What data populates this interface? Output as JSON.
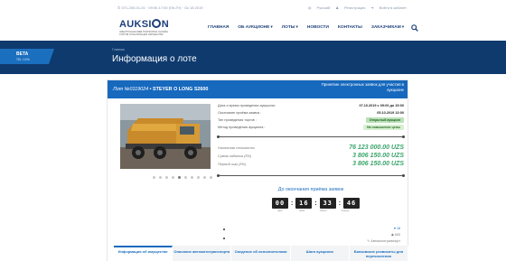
{
  "topbar": {
    "contacts": "✆ 371-200-01-01  ·  09:00-17:00 (Пн-Пт)  ·  Ок 18 2019",
    "language": "Русский",
    "register": "Регистрация",
    "login": "Войти в кабинет"
  },
  "logo": {
    "name_left": "AUKSI",
    "name_right": "N",
    "subtitle": "ЭЛЕКТРОННАЯ ВЕБ-ПЛАТФОРМА ОНЛАЙН ТОРГОВ И РЕАЛИЗАЦИИ ИМУЩЕСТВА"
  },
  "nav": {
    "items": [
      "ГЛАВНАЯ",
      "ОБ АУКЦИОНЕ",
      "ЛОТЫ",
      "НОВОСТИ",
      "КОНТАКТЫ",
      "ЗАКАЗЧИКАМ"
    ]
  },
  "hero": {
    "breadcrumb": "Главная",
    "title": "Информация о лоте"
  },
  "beta": {
    "label": "BETA",
    "sublabel": "TEL: 0.0%"
  },
  "lot": {
    "prefix": "Лот №",
    "number": "0119024",
    "name": "• STEYER O LONG S2600",
    "status": "Принятие электронных заявок для участия в аукционе"
  },
  "details": {
    "rows": [
      {
        "label": "Дата и время проведения аукциона:",
        "value": "07.10.2019 с 09:00 до 15:00"
      },
      {
        "label": "Окончание приёма заявок :",
        "value": "05.10.2019 13:00"
      },
      {
        "label": "Тип проведения торгов :",
        "value": "Открытый аукцион"
      },
      {
        "label": "Метод проведения аукциона :",
        "value": "На повышение цены"
      }
    ],
    "prices": [
      {
        "label": "Начальная стоимость",
        "value": "76 123 000.00 UZS"
      },
      {
        "label": "Сумма задатка (5%)",
        "value": "3 806 150.00 UZS"
      },
      {
        "label": "Первый шаг (5%)",
        "value": "3 806 150.00 UZS"
      }
    ]
  },
  "countdown": {
    "title": "До окончания приёма заявок",
    "days": "00",
    "hours": "16",
    "minutes": "33",
    "seconds": "46",
    "labels": [
      "Дни",
      "Часы",
      "Минут",
      "Секунд"
    ]
  },
  "meta": {
    "likes": "♥ 18",
    "views": "◉ 600",
    "category": "✎ Автомототранспорт"
  },
  "tabs": [
    "Информация об имуществе",
    "Описание автомототранспорта",
    "Сведение об исполнителями",
    "Шаги аукциона",
    "Банковские реквизиты для перечисления"
  ],
  "colors": {
    "hero": "#0e3a6e",
    "card_header": "#1769be",
    "price": "#3aa56a",
    "beta": "#1b6fbf"
  },
  "carousel": {
    "slides": 10,
    "active": 4
  }
}
